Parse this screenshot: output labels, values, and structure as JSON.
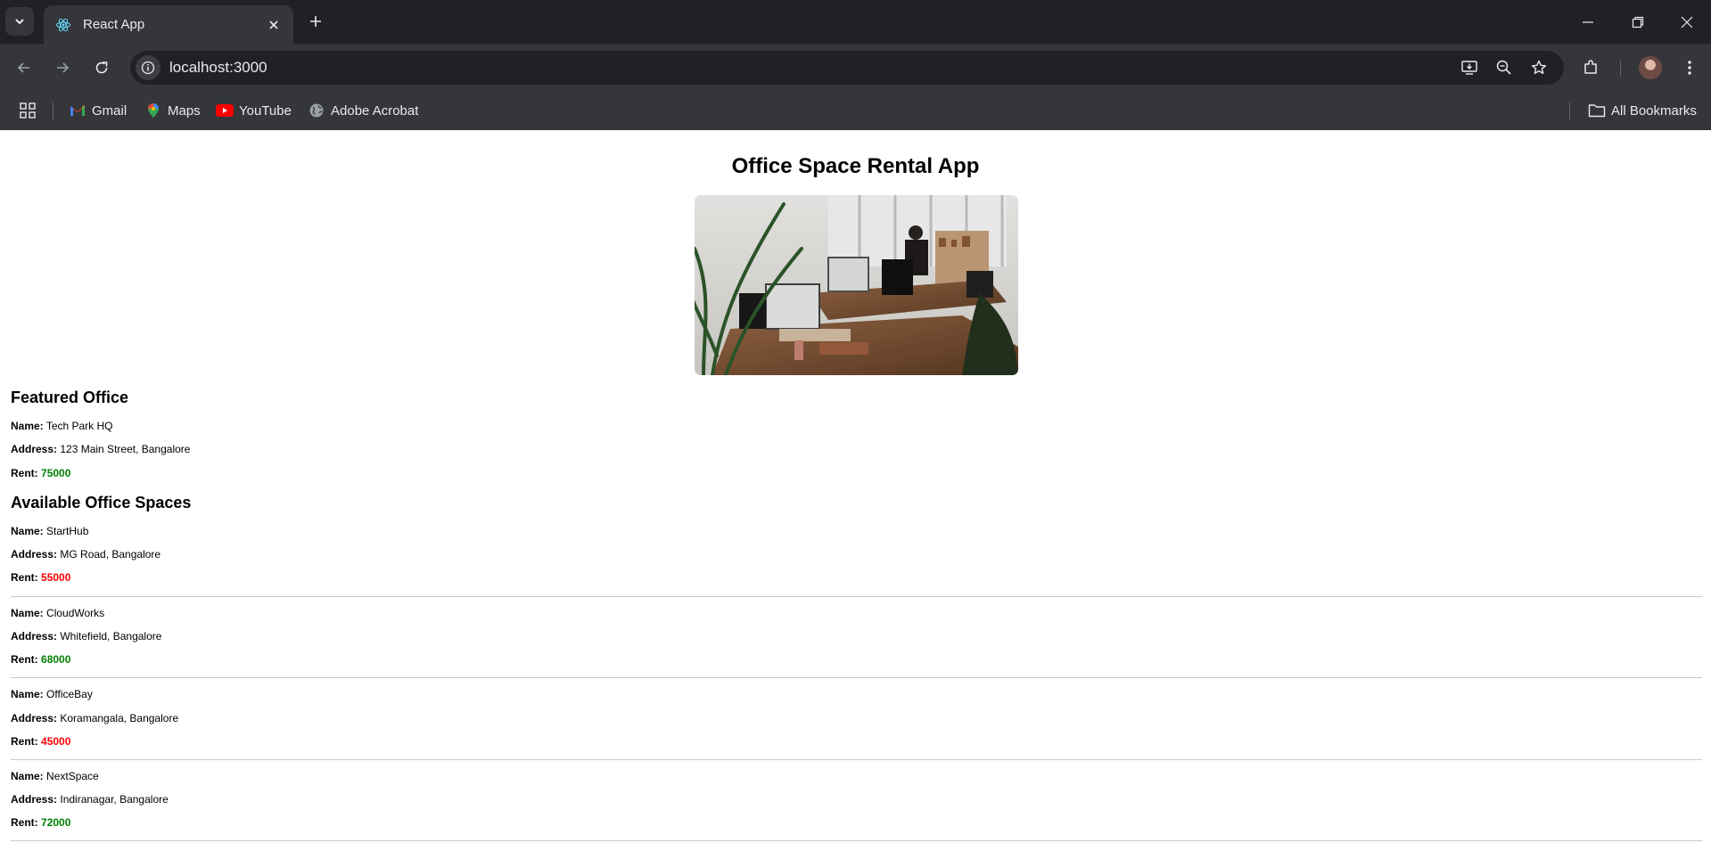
{
  "browser": {
    "tab_title": "React App",
    "url": "localhost:3000",
    "bookmarks": [
      "Gmail",
      "Maps",
      "YouTube",
      "Adobe Acrobat"
    ],
    "all_bookmarks": "All Bookmarks"
  },
  "page": {
    "title": "Office Space Rental App",
    "featured": {
      "heading": "Featured Office",
      "name_label": "Name:",
      "name": "Tech Park HQ",
      "address_label": "Address:",
      "address": "123 Main Street, Bangalore",
      "rent_label": "Rent:",
      "rent": "75000"
    },
    "available_heading": "Available Office Spaces",
    "offices": [
      {
        "name": "StartHub",
        "address": "MG Road, Bangalore",
        "rent": "55000",
        "rent_color": "red"
      },
      {
        "name": "CloudWorks",
        "address": "Whitefield, Bangalore",
        "rent": "68000",
        "rent_color": "green"
      },
      {
        "name": "OfficeBay",
        "address": "Koramangala, Bangalore",
        "rent": "45000",
        "rent_color": "red"
      },
      {
        "name": "NextSpace",
        "address": "Indiranagar, Bangalore",
        "rent": "72000",
        "rent_color": "green"
      }
    ]
  },
  "colors": {
    "rent_high": "#008000",
    "rent_low": "#ff0000"
  }
}
